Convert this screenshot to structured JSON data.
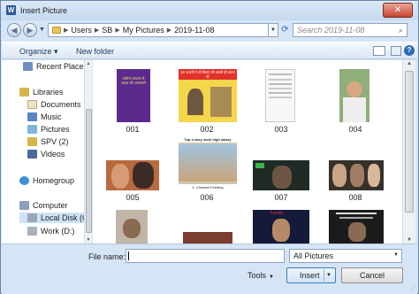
{
  "window": {
    "title": "Insert Picture",
    "app_icon_letter": "W",
    "close_glyph": "✕"
  },
  "address": {
    "breadcrumbs": [
      "Users",
      "SB",
      "My Pictures",
      "2019-11-08"
    ],
    "search_placeholder": "Search 2019-11-08"
  },
  "toolbar": {
    "organize_label": "Organize ▾",
    "new_folder_label": "New folder"
  },
  "sidebar": {
    "items": [
      {
        "label": "Recent Places",
        "icon": "recent-places-icon"
      },
      {
        "label": "Libraries",
        "icon": "libraries-icon"
      },
      {
        "label": "Documents",
        "icon": "documents-icon"
      },
      {
        "label": "Music",
        "icon": "music-icon"
      },
      {
        "label": "Pictures",
        "icon": "pictures-icon"
      },
      {
        "label": "SPV (2)",
        "icon": "libraries-icon"
      },
      {
        "label": "Videos",
        "icon": "videos-icon"
      },
      {
        "label": "Homegroup",
        "icon": "homegroup-icon"
      },
      {
        "label": "Computer",
        "icon": "computer-icon"
      },
      {
        "label": "Local Disk (C:",
        "icon": "local-disk-icon"
      },
      {
        "label": "Work (D:)",
        "icon": "drive-icon"
      }
    ]
  },
  "files": [
    {
      "name": "001",
      "thumb_text": "कोरोना वायरस से बचाव की जानकारी"
    },
    {
      "name": "002",
      "thumb_text": "इस आदमी ने तो दिमाग की कसरी ही करवा दी"
    },
    {
      "name": "003",
      "thumb_text": ""
    },
    {
      "name": "004",
      "thumb_text": ""
    },
    {
      "name": "005",
      "thumb_text": ""
    },
    {
      "name": "006",
      "thumb_text": "Top 4 easy work high salary",
      "thumb_caption": "4 .Cheetah Feeding"
    },
    {
      "name": "007",
      "thumb_text": ""
    },
    {
      "name": "008",
      "thumb_text": ""
    },
    {
      "name": "",
      "thumb_text": ""
    },
    {
      "name": "",
      "thumb_text": ""
    },
    {
      "name": "",
      "thumb_text": "Family"
    },
    {
      "name": "",
      "thumb_text": ""
    }
  ],
  "bottom": {
    "file_name_label": "File name:",
    "file_name_value": "",
    "file_type_value": "All Pictures",
    "tools_label": "Tools",
    "insert_label": "Insert",
    "cancel_label": "Cancel"
  },
  "colors": {
    "frame": "#d6e5f5",
    "accent": "#2b579a",
    "close": "#c7452d"
  }
}
